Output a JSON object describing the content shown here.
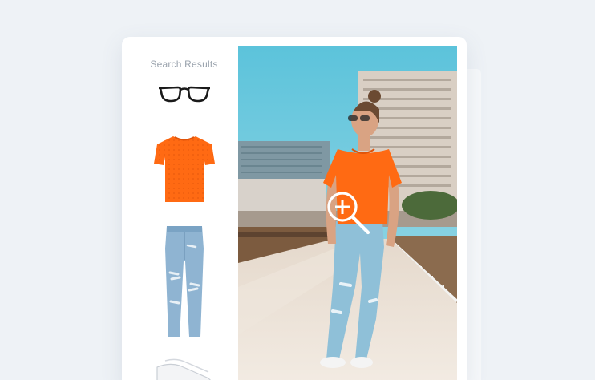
{
  "sidebar": {
    "title": "Search Results",
    "items": [
      {
        "icon": "glasses-icon"
      },
      {
        "icon": "orange-tshirt-icon"
      },
      {
        "icon": "jeans-icon"
      },
      {
        "icon": "sneakers-icon"
      }
    ]
  },
  "photo": {
    "zoom_icon": "zoom-in-icon"
  },
  "colors": {
    "background": "#eef2f6",
    "card": "#ffffff",
    "accent_orange": "#ff6a13",
    "denim": "#8fb4d2",
    "sky": "#6fc9de"
  }
}
